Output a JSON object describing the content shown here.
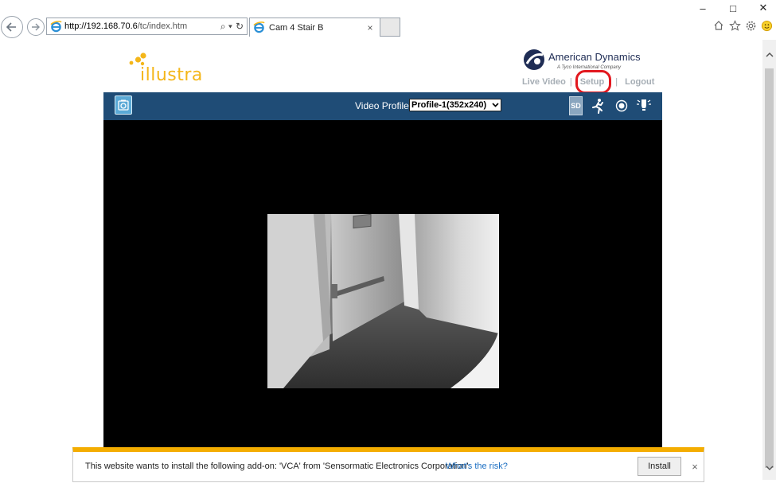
{
  "browser": {
    "url_host": "http://192.168.70.6",
    "url_path": "/tc/index.htm",
    "search_glyph": "⌕ ▾",
    "refresh_glyph": "↻",
    "tab_title": "Cam 4 Stair B",
    "tab_close": "×",
    "minimize": "–",
    "maximize": "□",
    "close": "✕"
  },
  "header": {
    "brand_logo_text": "illustra",
    "company_name": "American Dynamics",
    "company_tagline": "A Tyco International Company",
    "links": {
      "live_video": "Live Video",
      "separator": "|",
      "setup": "Setup",
      "logout": "Logout"
    },
    "highlight_color": "#e2181f"
  },
  "video_toolbar": {
    "profile_label": "Video Profile",
    "profile_selected": "Profile-1(352x240)",
    "sd_badge": "SD",
    "bg_color": "#1f4c76"
  },
  "notification": {
    "message": "This website wants to install the following add-on: 'VCA' from 'Sensormatic Electronics Corporation'.",
    "risk_link": "What's the risk?",
    "install_label": "Install",
    "close_label": "×",
    "accent_color": "#f4ad00"
  },
  "icons": {
    "back": "back-arrow-icon",
    "forward": "forward-arrow-icon",
    "home": "home-icon",
    "favorites": "star-icon",
    "settings": "gear-icon",
    "feedback": "smiley-icon",
    "snapshot": "camera-icon",
    "motion": "running-person-icon",
    "record": "record-icon",
    "light": "light-bulb-icon"
  }
}
